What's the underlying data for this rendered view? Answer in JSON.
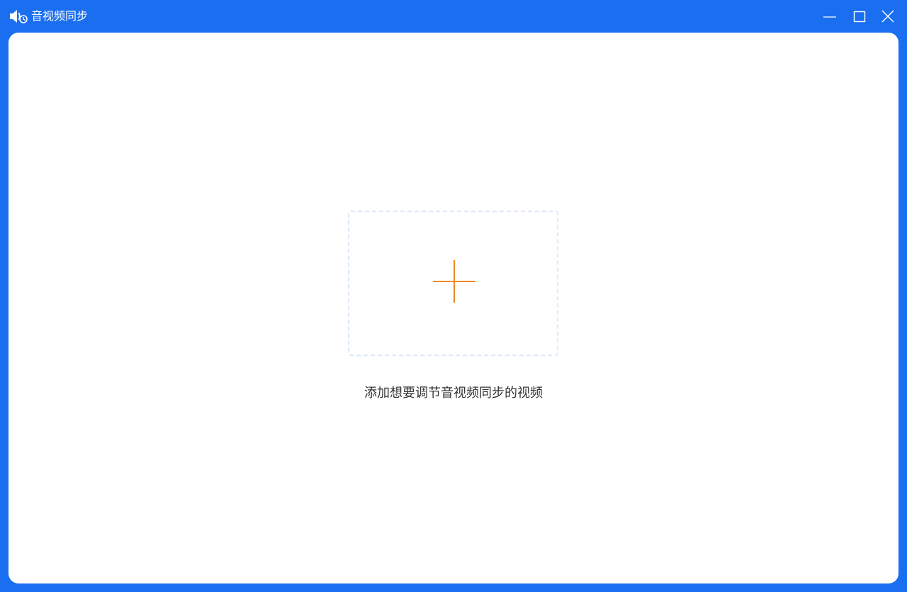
{
  "window": {
    "title": "音视频同步",
    "app_icon": "speaker-clock-icon",
    "controls": {
      "minimize": "minimize-icon",
      "maximize": "maximize-icon",
      "close": "close-icon"
    }
  },
  "main": {
    "add_icon": "plus-icon",
    "hint_text": "添加想要调节音视频同步的视频"
  },
  "colors": {
    "titlebar": "#1a6ff0",
    "accent": "#f08a24",
    "dash_border": "#dce9f8",
    "text": "#333333"
  }
}
